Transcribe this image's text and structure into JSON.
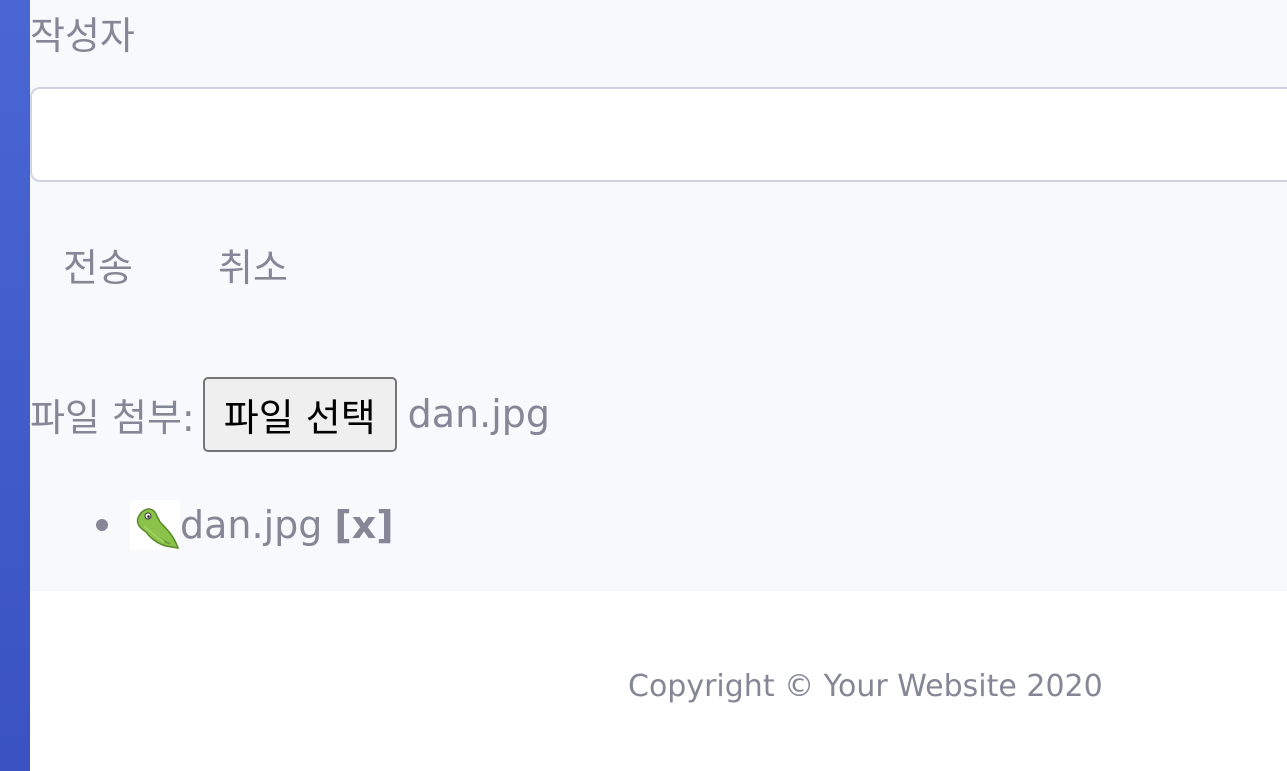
{
  "form": {
    "author_label": "작성자",
    "author_value": "",
    "submit_label": "전송",
    "cancel_label": "취소",
    "file_label": "파일 첨부:",
    "file_button_label": "파일 선택",
    "file_chosen": "dan.jpg"
  },
  "attachments": [
    {
      "name": "dan.jpg",
      "remove_label": "[x]",
      "thumbnail_icon": "caterpillar-pokemon-thumbnail"
    }
  ],
  "footer": {
    "copyright": "Copyright © Your Website 2020"
  },
  "colors": {
    "sidebar": "#4a66d4",
    "background": "#f8f9fc",
    "text": "#858796",
    "input_border": "#d1d3e2"
  }
}
